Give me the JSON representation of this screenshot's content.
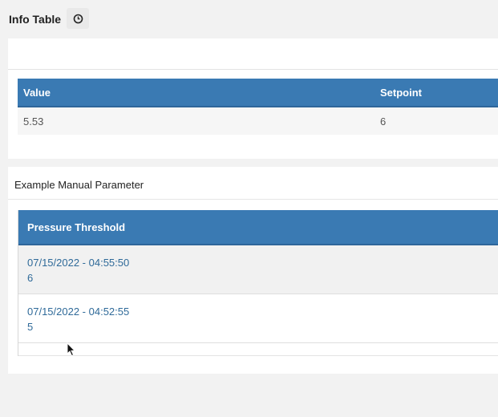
{
  "header": {
    "title": "Info Table",
    "refresh_icon": "clock-icon"
  },
  "info_table": {
    "columns": [
      "Value",
      "Setpoint"
    ],
    "rows": [
      [
        "5.53",
        "6"
      ]
    ]
  },
  "manual_parameter": {
    "title": "Example Manual Parameter",
    "column": "Pressure Threshold",
    "rows": [
      {
        "timestamp": "07/15/2022 - 04:55:50",
        "value": "6"
      },
      {
        "timestamp": "07/15/2022 - 04:52:55",
        "value": "5"
      }
    ]
  },
  "colors": {
    "header_blue": "#3a7ab3",
    "link_blue": "#2f6a99"
  }
}
